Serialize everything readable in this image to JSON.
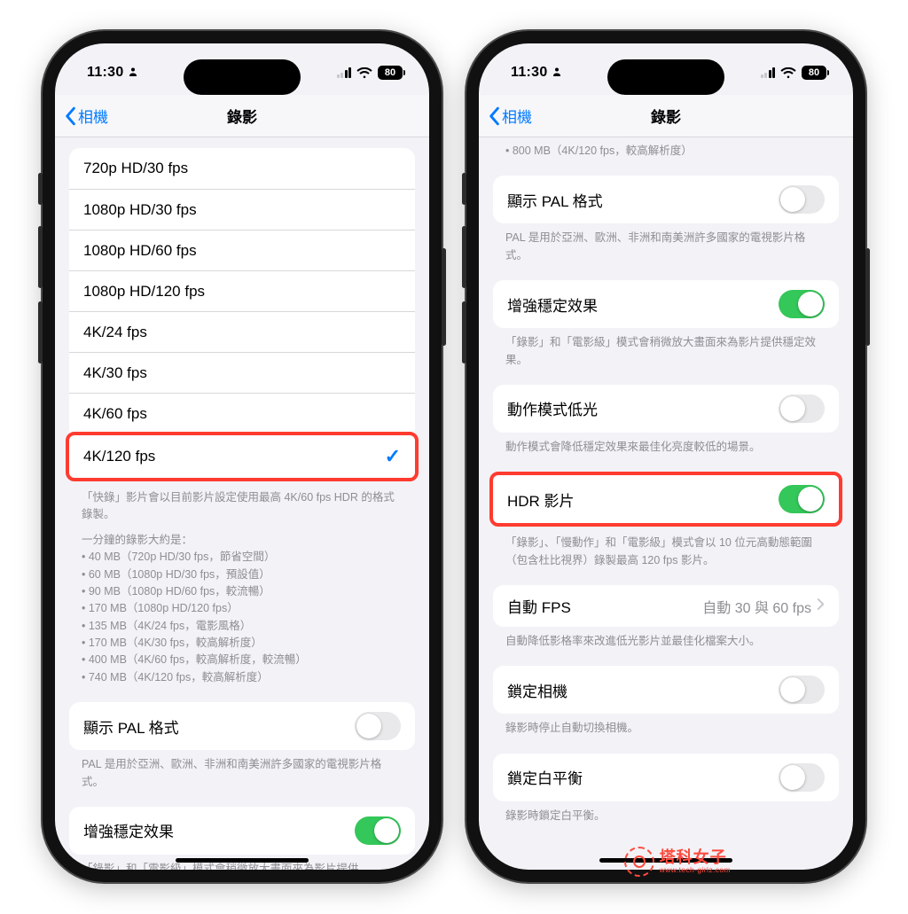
{
  "status": {
    "time": "11:30",
    "battery": "80"
  },
  "nav": {
    "back_label": "相機",
    "title": "錄影"
  },
  "phone1": {
    "options": [
      "720p HD/30 fps",
      "1080p HD/30 fps",
      "1080p HD/60 fps",
      "1080p HD/120 fps",
      "4K/24 fps",
      "4K/30 fps",
      "4K/60 fps"
    ],
    "selected": "4K/120 fps",
    "footnote1": "「快錄」影片會以目前影片設定使用最高 4K/60 fps HDR 的格式錄製。",
    "footnote2_head": "一分鐘的錄影大約是：",
    "footnote2_items": "• 40 MB（720p HD/30 fps，節省空間）\n• 60 MB（1080p HD/30 fps，預設值）\n• 90 MB（1080p HD/60 fps，較流暢）\n• 170 MB（1080p HD/120 fps）\n• 135 MB（4K/24 fps，電影風格）\n• 170 MB（4K/30 fps，較高解析度）\n• 400 MB（4K/60 fps，較高解析度，較流暢）\n• 740 MB（4K/120 fps，較高解析度）",
    "pal_label": "顯示 PAL 格式",
    "pal_footer": "PAL 是用於亞洲、歐洲、非洲和南美洲許多國家的電視影片格式。",
    "stab_label": "增強穩定效果",
    "stab_footer": "「錄影」和「電影級」模式會稍微放大畫面來為影片提供"
  },
  "phone2": {
    "top_footer": "• 800 MB（4K/120 fps，較高解析度）",
    "pal_label": "顯示 PAL 格式",
    "pal_footer": "PAL 是用於亞洲、歐洲、非洲和南美洲許多國家的電視影片格式。",
    "stab_label": "增強穩定效果",
    "stab_footer": "「錄影」和「電影級」模式會稍微放大畫面來為影片提供穩定效果。",
    "action_label": "動作模式低光",
    "action_footer": "動作模式會降低穩定效果來最佳化亮度較低的場景。",
    "hdr_label": "HDR 影片",
    "hdr_footer": "「錄影」、「慢動作」和「電影級」模式會以 10 位元高動態範圍（包含杜比視界）錄製最高 120 fps 影片。",
    "autofps_label": "自動 FPS",
    "autofps_value": "自動 30 與 60 fps",
    "autofps_footer": "自動降低影格率來改進低光影片並最佳化檔案大小。",
    "lockcam_label": "鎖定相機",
    "lockcam_footer": "錄影時停止自動切換相機。",
    "lockwb_label": "鎖定白平衡",
    "lockwb_footer": "錄影時鎖定白平衡。"
  },
  "watermark": {
    "main": "塔科女子",
    "sub": "www.tech-girlz.com"
  }
}
